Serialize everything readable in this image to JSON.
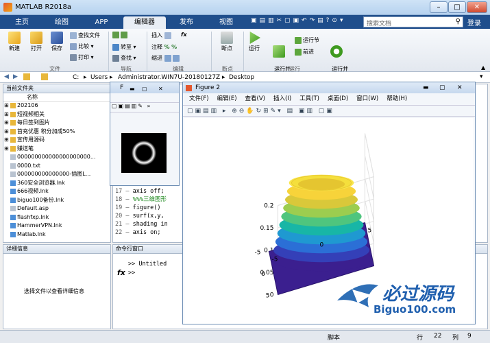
{
  "window": {
    "title": "MATLAB R2018a"
  },
  "tabs": [
    "主页",
    "绘图",
    "APP",
    "编辑器",
    "发布",
    "视图"
  ],
  "search": {
    "placeholder": "搜索文档"
  },
  "login": "登录",
  "ribbon": {
    "file": {
      "new": "新建",
      "open": "打开",
      "save": "保存",
      "find_files": "查找文件",
      "compare": "比较",
      "print": "打印",
      "group": "文件"
    },
    "nav": {
      "goto": "转至",
      "find": "查找",
      "group": "导航"
    },
    "edit": {
      "insert": "插入",
      "comment": "注释",
      "indent": "缩进",
      "fx": "fx",
      "group": "编辑"
    },
    "bp": {
      "breakpoint": "断点",
      "group": "断点"
    },
    "run": {
      "run": "运行",
      "run_advance": "运行并\n前进",
      "run_section": "运行节",
      "advance": "前进",
      "run_time": "运行并\n计时",
      "group": "运行"
    }
  },
  "address": {
    "path": [
      "C:",
      "Users",
      "Administrator.WIN7U-20180127Z",
      "Desktop"
    ]
  },
  "current_folder": {
    "header": "当前文件夹",
    "col_name": "名称",
    "items": [
      "202106",
      "短视频相关",
      "每日签到图片",
      "首充优惠 积分加成50%",
      "宣传用源码",
      "赚送笔",
      "000000000000000000000...",
      "0000.txt",
      "000000000000000-插图L...",
      "360安全浏览器.lnk",
      "666视频.lnk",
      "biguo100备份.lnk",
      "Default.asp",
      "flashfxp.lnk",
      "HammerVPN.lnk",
      "Matlab.lnk"
    ]
  },
  "details": {
    "header": "详细信息",
    "hint": "选择文件以查看详细信息"
  },
  "editor": {
    "lines": [
      {
        "n": "17",
        "code": "axis off;"
      },
      {
        "n": "18",
        "code": "%%%三维图形"
      },
      {
        "n": "19",
        "code": "figure()"
      },
      {
        "n": "20",
        "code": "surf(x,y,"
      },
      {
        "n": "21",
        "code": "shading in"
      },
      {
        "n": "22",
        "code": "axis on;"
      }
    ]
  },
  "command": {
    "header": "命令行窗口",
    "line1": ">> Untitled",
    "prompt": ">>",
    "fx": "fx"
  },
  "figure2": {
    "title": "Figure 2",
    "menu": [
      "文件(F)",
      "编辑(E)",
      "查看(V)",
      "插入(I)",
      "工具(T)",
      "桌面(D)",
      "窗口(W)",
      "帮助(H)"
    ]
  },
  "chart_data": {
    "type": "surface",
    "title": "",
    "zlim": [
      0,
      0.2
    ],
    "z_ticks": [
      "0",
      "0.05",
      "0.1",
      "0.15",
      "0.2"
    ],
    "x_ticks": [
      "-5",
      "0",
      "5"
    ],
    "y_ticks": [
      "5",
      "0",
      "-5"
    ],
    "description_values": {
      "ring_height": 0.17
    }
  },
  "watermark": {
    "cn": "必过源码",
    "url": "Biguo100.com"
  },
  "status": {
    "mode": "脚本",
    "row_label": "行",
    "row": "22",
    "col_label": "列",
    "col": "9"
  },
  "colors": {
    "ribbon_tab_bg": "#1f4e8c",
    "accent": "#2f6fb6"
  }
}
